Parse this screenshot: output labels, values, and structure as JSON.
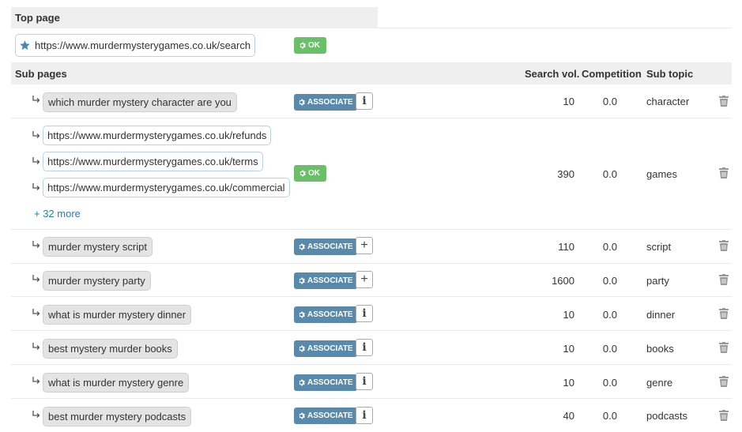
{
  "top_page": {
    "heading": "Top page",
    "url": "https://www.murdermysterygames.co.uk/search",
    "status": "OK"
  },
  "sub_pages": {
    "heading": "Sub pages",
    "columns": {
      "search_vol": "Search vol.",
      "competition": "Competition",
      "sub_topic": "Sub topic"
    },
    "rows": [
      {
        "keyword": "which murder mystery character are you",
        "action": "ASSOCIATE",
        "extra": "info",
        "search_vol": "10",
        "competition": "0.0",
        "sub_topic": "character"
      },
      {
        "urls": [
          "https://www.murdermysterygames.co.uk/refunds",
          "https://www.murdermysterygames.co.uk/terms",
          "https://www.murdermysterygames.co.uk/commercial"
        ],
        "more": "+ 32 more",
        "action": "OK",
        "search_vol": "390",
        "competition": "0.0",
        "sub_topic": "games"
      },
      {
        "keyword": "murder mystery script",
        "action": "ASSOCIATE",
        "extra": "plus",
        "search_vol": "110",
        "competition": "0.0",
        "sub_topic": "script"
      },
      {
        "keyword": "murder mystery party",
        "action": "ASSOCIATE",
        "extra": "plus",
        "search_vol": "1600",
        "competition": "0.0",
        "sub_topic": "party"
      },
      {
        "keyword": "what is murder mystery dinner",
        "action": "ASSOCIATE",
        "extra": "info",
        "search_vol": "10",
        "competition": "0.0",
        "sub_topic": "dinner"
      },
      {
        "keyword": "best mystery murder books",
        "action": "ASSOCIATE",
        "extra": "info",
        "search_vol": "10",
        "competition": "0.0",
        "sub_topic": "books"
      },
      {
        "keyword": "what is murder mystery genre",
        "action": "ASSOCIATE",
        "extra": "info",
        "search_vol": "10",
        "competition": "0.0",
        "sub_topic": "genre"
      },
      {
        "keyword": "best murder mystery podcasts",
        "action": "ASSOCIATE",
        "extra": "info",
        "search_vol": "40",
        "competition": "0.0",
        "sub_topic": "podcasts"
      }
    ]
  },
  "icons": {
    "star": "star-icon",
    "gear": "gear-icon",
    "info": "info-icon",
    "plus": "plus-icon",
    "trash": "trash-icon",
    "arrow": "subdirectory-arrow-icon"
  },
  "colors": {
    "associate": "#5a8aab",
    "ok": "#6abf69",
    "link": "#2a7ab8",
    "star": "#4a86b8"
  }
}
